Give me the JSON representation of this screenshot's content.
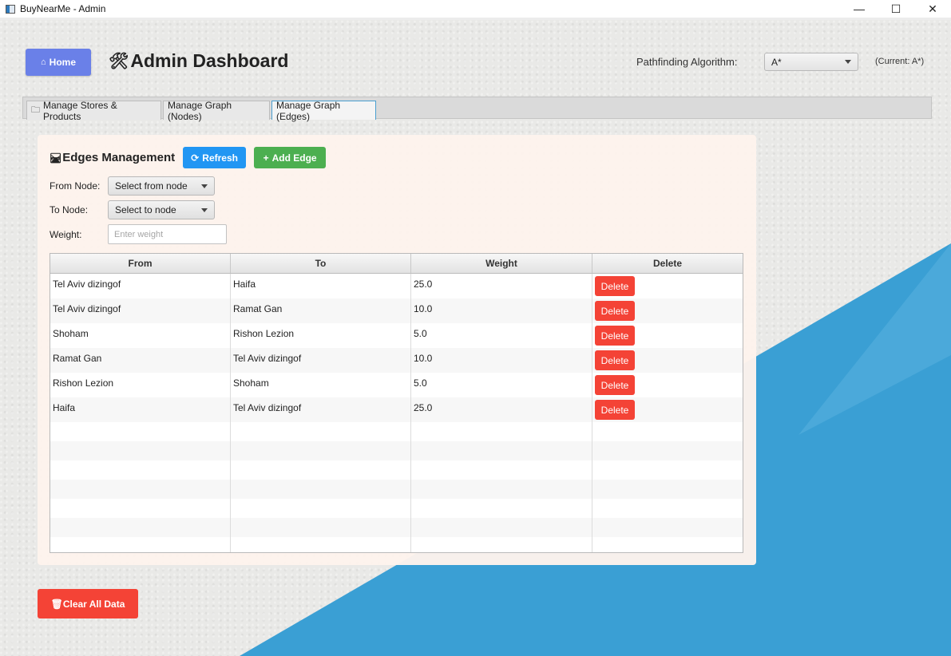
{
  "window": {
    "title": "BuyNearMe - Admin",
    "minimize": "—",
    "maximize": "☐",
    "close": "✕"
  },
  "header": {
    "home_label": "Home",
    "home_icon": "⌂",
    "title": "Admin Dashboard",
    "title_icon": "🛠",
    "algorithm_label": "Pathfinding Algorithm:",
    "algorithm_value": "A*",
    "algorithm_current": "(Current: A*)"
  },
  "tabs": [
    {
      "label": "Manage Stores & Products",
      "icon": "🗀"
    },
    {
      "label": "Manage Graph (Nodes)"
    },
    {
      "label": "Manage Graph (Edges)",
      "active": true
    }
  ],
  "edges_panel": {
    "title": "Edges Management",
    "title_icon": "🛤",
    "refresh_label": "Refresh",
    "refresh_icon": "⟳",
    "add_label": "Add Edge",
    "add_icon": "+",
    "from_label": "From Node:",
    "from_value": "Select from node",
    "to_label": "To Node:",
    "to_value": "Select to node",
    "weight_label": "Weight:",
    "weight_placeholder": "Enter weight"
  },
  "table": {
    "columns": [
      "From",
      "To",
      "Weight",
      "Delete"
    ],
    "delete_label": "Delete",
    "rows": [
      {
        "from": "Tel Aviv dizingof",
        "to": "Haifa",
        "weight": "25.0"
      },
      {
        "from": "Tel Aviv dizingof",
        "to": "Ramat Gan",
        "weight": "10.0"
      },
      {
        "from": "Shoham",
        "to": "Rishon Lezion",
        "weight": "5.0"
      },
      {
        "from": "Ramat Gan",
        "to": "Tel Aviv dizingof",
        "weight": "10.0"
      },
      {
        "from": "Rishon Lezion",
        "to": "Shoham",
        "weight": "5.0"
      },
      {
        "from": "Haifa",
        "to": "Tel Aviv dizingof",
        "weight": "25.0"
      }
    ]
  },
  "footer": {
    "clear_label": "Clear All Data",
    "clear_icon": "🗑"
  },
  "colors": {
    "home": "#6a80e8",
    "refresh": "#2196f3",
    "add": "#4caf50",
    "delete": "#f44336",
    "background_blue": "#3a9fd4"
  }
}
